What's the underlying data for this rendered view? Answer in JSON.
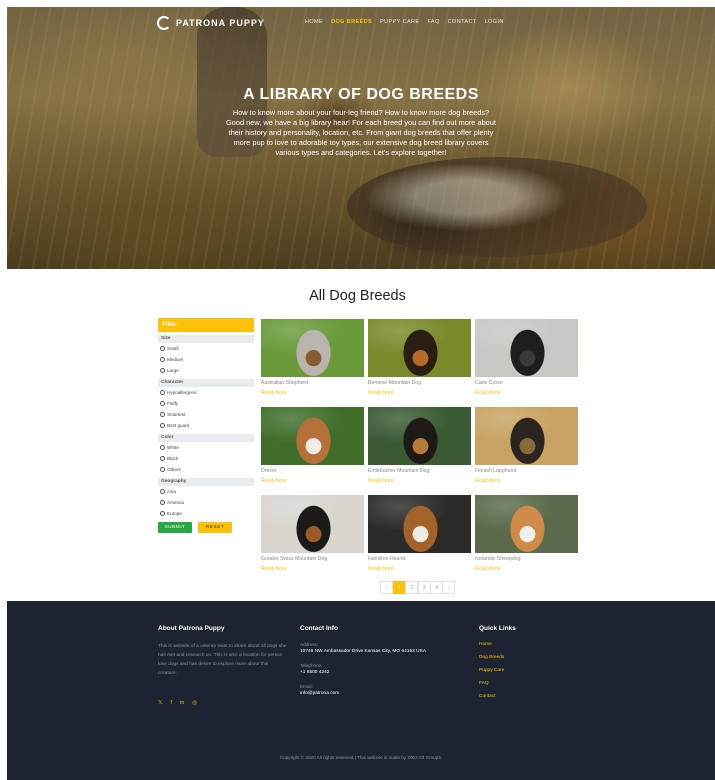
{
  "brand": {
    "name": "PATRONA PUPPY"
  },
  "nav": {
    "items": [
      {
        "label": "HOME"
      },
      {
        "label": "DOG BREEDS"
      },
      {
        "label": "PUPPY CARE"
      },
      {
        "label": "FAQ"
      },
      {
        "label": "CONTACT"
      },
      {
        "label": "LOGIN"
      }
    ],
    "active_index": 1
  },
  "hero": {
    "title": "A LIBRARY OF DOG BREEDS",
    "description": "How to know more about your four-leg friend? How to know more dog breeds? Good new, we have a big library hear! For each breed you can find out more about their history and personality, location, etc. From giant dog breeds that offer plenty more pup to love to adorable toy types, our extensive dog breed library covers various types and categories. Let's explore together!"
  },
  "main": {
    "title": "All Dog Breeds"
  },
  "filter": {
    "title": "Filter",
    "groups": [
      {
        "label": "Size",
        "options": [
          "Small",
          "Medium",
          "Large"
        ]
      },
      {
        "label": "Character",
        "options": [
          "Hypoallergenic",
          "Fluffy",
          "Smartest",
          "Best guard"
        ]
      },
      {
        "label": "Color",
        "options": [
          "White",
          "Black",
          "Others"
        ]
      },
      {
        "label": "Geography",
        "options": [
          "Asia",
          "America",
          "Europe"
        ]
      }
    ],
    "submit_label": "SUBMIT",
    "reset_label": "RESET"
  },
  "breeds": [
    {
      "name": "Australian Shepherd",
      "link": "Read more",
      "colors": [
        "#6a9a3a",
        "#b9b4ae",
        "#8a5a32"
      ]
    },
    {
      "name": "Bernese Mountain Dog",
      "link": "Read more",
      "colors": [
        "#7a8a2a",
        "#2a1e14",
        "#b56a2a"
      ]
    },
    {
      "name": "Cane Corso",
      "link": "Read more",
      "colors": [
        "#c9c7c1",
        "#1e1e20",
        "#3a3a3c"
      ]
    },
    {
      "name": "Drever",
      "link": "Read more",
      "colors": [
        "#3f6e2a",
        "#b5713a",
        "#f0ece4"
      ]
    },
    {
      "name": "Entlebucher Mountain Dog",
      "link": "Read more",
      "colors": [
        "#3a5a34",
        "#1e1a18",
        "#b5793a"
      ]
    },
    {
      "name": "Finnish Lapphund",
      "link": "Read more",
      "colors": [
        "#c8a262",
        "#2c2420",
        "#8a6a3a"
      ]
    },
    {
      "name": "Greater Swiss Mountain Dog",
      "link": "Read more",
      "colors": [
        "#d8d5cf",
        "#1c1a18",
        "#9a5a2a"
      ]
    },
    {
      "name": "Hamilton Hound",
      "link": "Read more",
      "colors": [
        "#2c2a28",
        "#a3622a",
        "#f0ece4"
      ]
    },
    {
      "name": "Icelandic Sheepdog",
      "link": "Read more",
      "colors": [
        "#5a6a4a",
        "#d08a4a",
        "#f2eee8"
      ]
    }
  ],
  "pagination": {
    "prev": "‹",
    "pages": [
      "1",
      "2",
      "3",
      "4"
    ],
    "next": "›",
    "current": "1"
  },
  "footer": {
    "about_title": "About Patrona Puppy",
    "about_text": "This is website of a veteran want to share about all dogs she has met and research on. This is also a location for person love dogs and has desire to explore more about this creature.",
    "socials": [
      "twitter-icon",
      "facebook-icon",
      "linkedin-icon",
      "instagram-icon"
    ],
    "contact_title": "Contact Info",
    "address_label": "Address:",
    "address": "10749 NW Ambassador Drive Kansas City, MO 64153 USA",
    "phone_label": "Telephone:",
    "phone": "+1 6500 4242",
    "email_label": "Email:",
    "email": "info@patrona.com",
    "links_title": "Quick Links",
    "links": [
      "Home",
      "Dog Breeds",
      "Puppy Care",
      "FAQ",
      "Contact"
    ],
    "copyright": "Copyright © 2020 All rights reserved | This website is made by 2002-03 Group4."
  },
  "theme": {
    "accent": "#ffc107",
    "success": "#28a745",
    "footer_bg": "#1d2330"
  }
}
